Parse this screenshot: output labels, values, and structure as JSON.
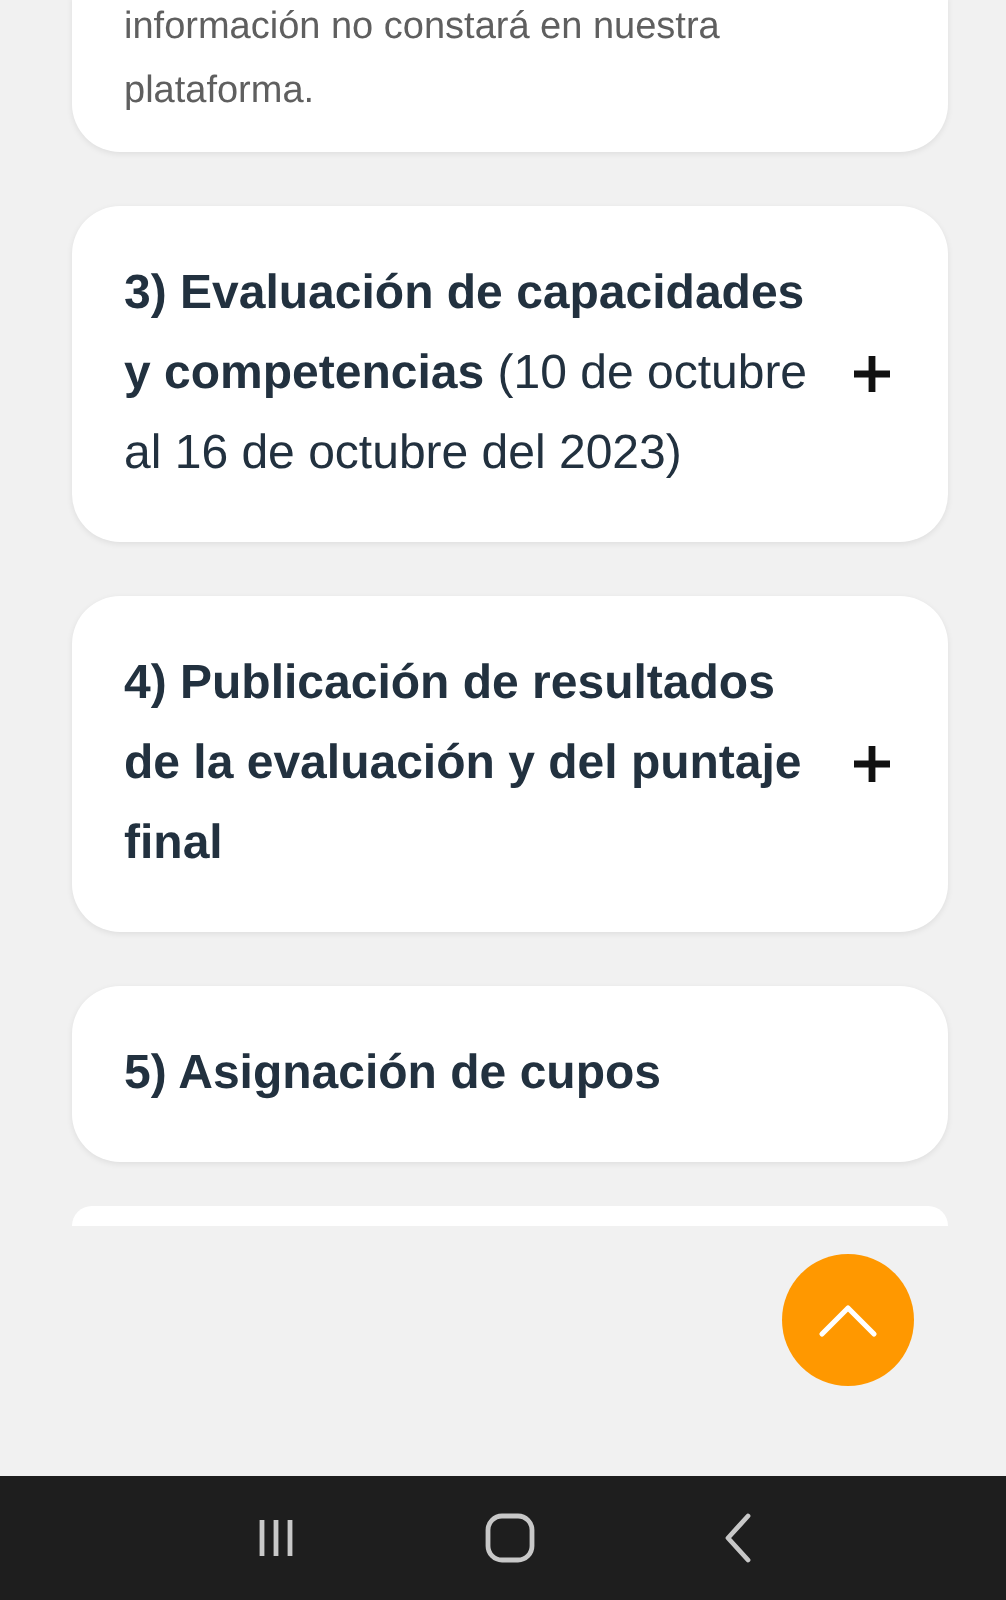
{
  "intro_card": {
    "lines": [
      "información no constará en nuestra",
      "plataforma."
    ]
  },
  "steps": [
    {
      "text": "**3) Evaluación de capacidades y competencias** (10 de octubre al 16 de octubre del 2023)",
      "expanded": false
    },
    {
      "text": "4) Publicación de resultados de la evaluación y del puntaje final",
      "expanded": false
    },
    {
      "text": "5) Asignación de cupos"
    }
  ]
}
